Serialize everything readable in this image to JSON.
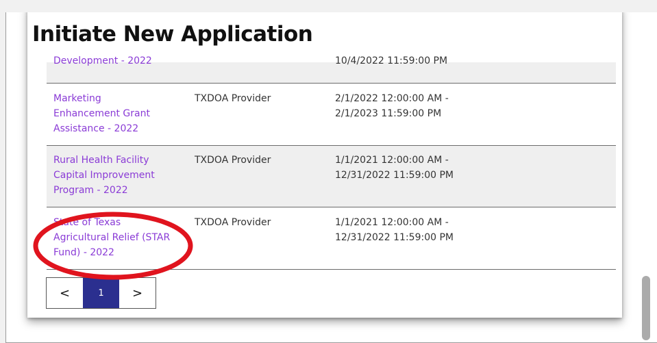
{
  "page": {
    "title": "Initiate New Application"
  },
  "table": {
    "rows": [
      {
        "program_lines": [
          "",
          "Development - 2022"
        ],
        "provider": "",
        "period_lines": [
          "",
          "10/4/2022 11:59:00 PM"
        ]
      },
      {
        "program_lines": [
          "Marketing",
          "Enhancement Grant",
          "Assistance - 2022"
        ],
        "provider": "TXDOA Provider",
        "period_lines": [
          "2/1/2022 12:00:00 AM -",
          "2/1/2023 11:59:00 PM"
        ]
      },
      {
        "program_lines": [
          "Rural Health Facility",
          "Capital Improvement",
          "Program - 2022"
        ],
        "provider": "TXDOA Provider",
        "period_lines": [
          "1/1/2021 12:00:00 AM -",
          "12/31/2022 11:59:00 PM"
        ]
      },
      {
        "program_lines": [
          "State of Texas",
          "Agricultural Relief (STAR",
          "Fund) - 2022"
        ],
        "provider": "TXDOA Provider",
        "period_lines": [
          "1/1/2021 12:00:00 AM -",
          "12/31/2022 11:59:00 PM"
        ]
      }
    ]
  },
  "pagination": {
    "prev": "<",
    "current": "1",
    "next": ">"
  },
  "colors": {
    "link": "#8a3bd6",
    "active_page": "#2b2f8f",
    "annotation": "#e0141e"
  }
}
